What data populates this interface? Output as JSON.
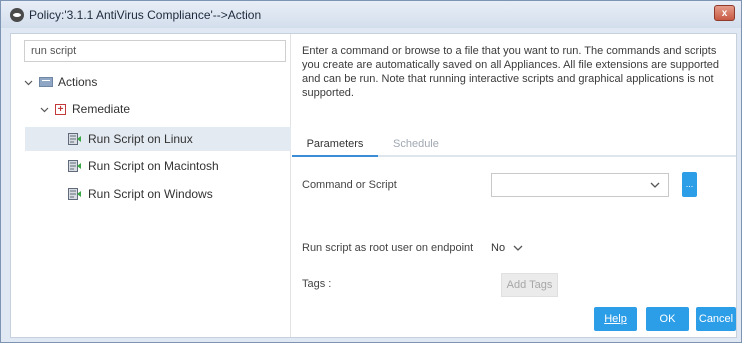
{
  "window": {
    "title": "Policy:'3.1.1 AntiVirus Compliance'-->Action",
    "close_label": "x"
  },
  "search": {
    "value": "run script"
  },
  "tree": {
    "root": "Actions",
    "group": "Remediate",
    "items": [
      {
        "label": "Run Script on Linux",
        "selected": true
      },
      {
        "label": "Run Script on Macintosh",
        "selected": false
      },
      {
        "label": "Run Script on Windows",
        "selected": false
      }
    ]
  },
  "description": "Enter a command or browse to a file that you want to run. The commands and scripts you create are automatically saved on all Appliances. All file extensions are supported and can be run. Note that running interactive scripts and graphical applications is not supported.",
  "tabs": [
    {
      "label": "Parameters",
      "active": true
    },
    {
      "label": "Schedule",
      "active": false
    }
  ],
  "form": {
    "command_label": "Command or Script",
    "command_value": "",
    "browse_label": "...",
    "root_label": "Run script as root user on endpoint",
    "root_value": "No",
    "tags_label": "Tags :",
    "add_tags_label": "Add Tags"
  },
  "footer": {
    "help": "Help",
    "ok": "OK",
    "cancel": "Cancel"
  },
  "colors": {
    "accent": "#2c9ee8",
    "selected_row": "#e3eaf2",
    "window_frame": "#dfe8f3"
  }
}
